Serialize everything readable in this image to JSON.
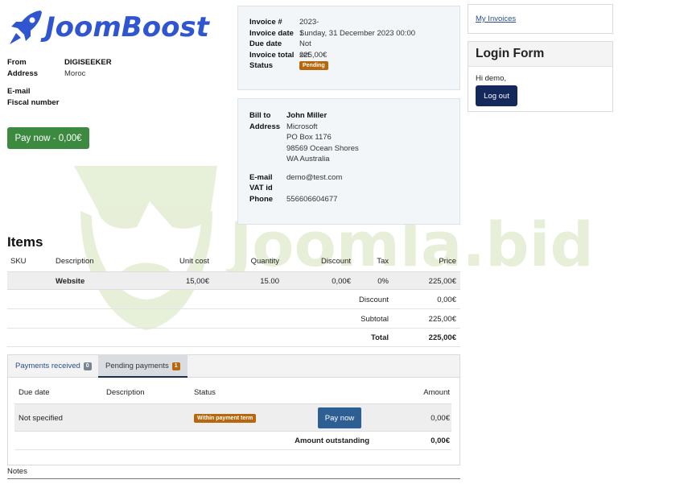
{
  "logo": {
    "text": "JoomBoost",
    "icon": "rocket-icon"
  },
  "watermark": {
    "text": "Joomla.bid"
  },
  "seller": {
    "from_label": "From",
    "from_value": "DIGISEEKER",
    "address_label": "Address",
    "address_value": "Moroc",
    "email_label": "E-mail",
    "fiscal_label": "Fiscal number"
  },
  "pay_now_main": "Pay now - 0,00€",
  "invoice": {
    "number_label": "Invoice #",
    "number_value": "2023-1",
    "date_label": "Invoice date",
    "date_value": "Sunday, 31 December 2023 00:00",
    "due_label": "Due date",
    "due_value": "Not set",
    "total_label": "Invoice total",
    "total_value": "225,00€",
    "status_label": "Status",
    "status_value": "Pending"
  },
  "bill_to": {
    "bill_label": "Bill to",
    "bill_value": "John Miller",
    "address_label": "Address",
    "address_lines": [
      "Microsoft",
      "PO Box 1176",
      "98569 Ocean Shores",
      "WA Australia"
    ],
    "email_label": "E-mail",
    "email_value": "demo@test.com",
    "vat_label": "VAT id",
    "phone_label": "Phone",
    "phone_value": "556606604677"
  },
  "sidebar": {
    "my_invoices": "My Invoices",
    "login_title": "Login Form",
    "greeting": "Hi demo,",
    "logout": "Log out"
  },
  "items": {
    "title": "Items",
    "headers": [
      "SKU",
      "Description",
      "Unit cost",
      "Quantity",
      "Discount",
      "Tax",
      "Price"
    ],
    "rows": [
      {
        "sku": "",
        "description": "Website",
        "unit_cost": "15,00€",
        "quantity": "15.00",
        "discount": "0,00€",
        "tax": "0%",
        "price": "225,00€"
      }
    ],
    "summary": [
      {
        "label": "Discount",
        "value": "0,00€"
      },
      {
        "label": "Subtotal",
        "value": "225,00€"
      },
      {
        "label": "Total",
        "value": "225,00€"
      }
    ]
  },
  "payments": {
    "tabs": [
      {
        "label": "Payments received",
        "count": "0",
        "color": "#7a8592"
      },
      {
        "label": "Pending payments",
        "count": "1",
        "color": "#b8680c"
      }
    ],
    "headers": {
      "due_date": "Due date",
      "description": "Description",
      "status": "Status",
      "amount": "Amount"
    },
    "rows": [
      {
        "due_date": "Not specified",
        "description": "",
        "status": "Within payment term",
        "action": "Pay now",
        "amount": "0,00€"
      }
    ],
    "outstanding_label": "Amount outstanding",
    "outstanding_value": "0,00€"
  },
  "notes_label": "Notes",
  "colors": {
    "brand": "#2f56d0",
    "pay_green": "#3b8a3f",
    "pending": "#b8680c",
    "navy": "#14285c",
    "pay_blue": "#2d5f93"
  }
}
